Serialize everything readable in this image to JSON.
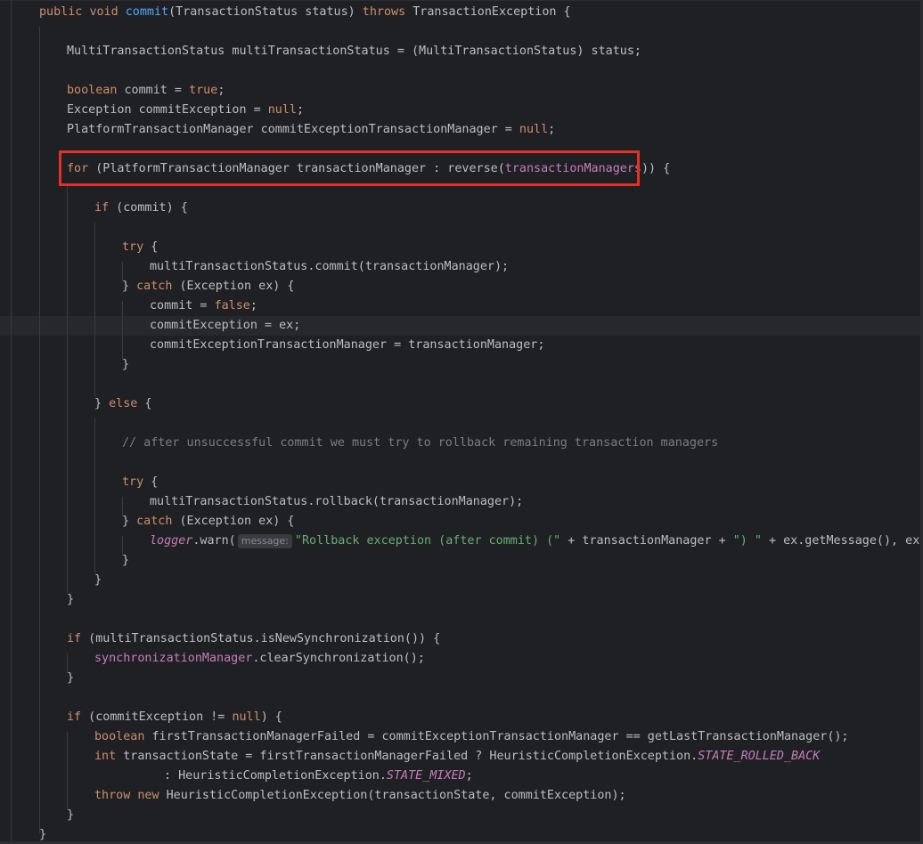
{
  "editor": {
    "language": "java",
    "lines": {
      "l1": [
        "public",
        " ",
        "void",
        " ",
        "commit",
        "(TransactionStatus status) ",
        "throws",
        " TransactionException {"
      ],
      "l3": [
        "MultiTransactionStatus multiTransactionStatus = (MultiTransactionStatus) status;"
      ],
      "l5": [
        "boolean",
        " commit = ",
        "true",
        ";"
      ],
      "l6": [
        "Exception commitException = ",
        "null",
        ";"
      ],
      "l7": [
        "PlatformTransactionManager commitExceptionTransactionManager = ",
        "null",
        ";"
      ],
      "l9": [
        "for",
        " (PlatformTransactionManager transactionManager : reverse(",
        "transactionManagers",
        ")) {"
      ],
      "l11": [
        "if",
        " (commit) {"
      ],
      "l13": [
        "try",
        " {"
      ],
      "l14": [
        "multiTransactionStatus.commit(transactionManager);"
      ],
      "l15": [
        "} ",
        "catch",
        " (Exception ex) {"
      ],
      "l16": [
        "commit = ",
        "false",
        ";"
      ],
      "l17": [
        "commitException = ex;"
      ],
      "l18": [
        "commitExceptionTransactionManager = transactionManager;"
      ],
      "l19": [
        "}"
      ],
      "l21": [
        "} ",
        "else",
        " {"
      ],
      "l23": [
        "// after unsuccessful commit we must try to rollback remaining transaction managers"
      ],
      "l25": [
        "try",
        " {"
      ],
      "l26": [
        "multiTransactionStatus.rollback(transactionManager);"
      ],
      "l27": [
        "} ",
        "catch",
        " (Exception ex) {"
      ],
      "l28": [
        "logger",
        ".warn(",
        "message:",
        "\"Rollback exception (after commit) (\"",
        " + transactionManager + ",
        "\") \"",
        " + ex.getMessage(), ex);"
      ],
      "l29": [
        "}"
      ],
      "l30": [
        "}"
      ],
      "l31": [
        "}"
      ],
      "l33": [
        "if",
        " (multiTransactionStatus.isNewSynchronization()) {"
      ],
      "l34": [
        "synchronizationManager",
        ".clearSynchronization();"
      ],
      "l35": [
        "}"
      ],
      "l37": [
        "if",
        " (commitException != ",
        "null",
        ") {"
      ],
      "l38": [
        "boolean",
        " firstTransactionManagerFailed = commitExceptionTransactionManager == getLastTransactionManager();"
      ],
      "l39": [
        "int",
        " transactionState = firstTransactionManagerFailed ? HeuristicCompletionException.",
        "STATE_ROLLED_BACK"
      ],
      "l40": [
        ": HeuristicCompletionException.",
        "STATE_MIXED",
        ";"
      ],
      "l41": [
        "throw",
        " ",
        "new",
        " HeuristicCompletionException(transactionState, commitException);"
      ],
      "l42": [
        "}"
      ],
      "l43": [
        "}"
      ]
    }
  },
  "colors": {
    "background": "#1f2023",
    "keyword": "#cf8e6d",
    "method_declaration": "#56a8f5",
    "field": "#c77dbb",
    "string": "#6aab73",
    "comment": "#7a7e85",
    "highlight_box": "#e33127"
  }
}
